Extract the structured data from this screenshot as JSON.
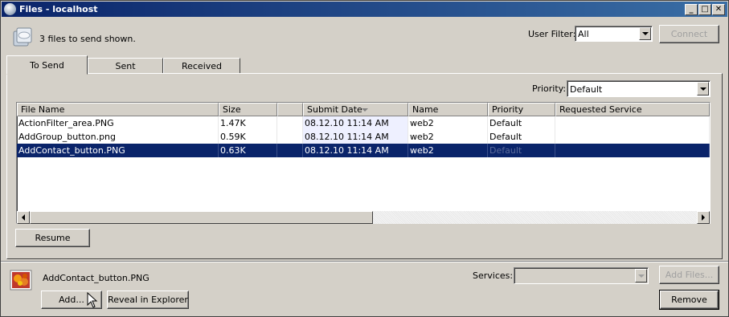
{
  "window": {
    "title": "Files - localhost",
    "min_glyph": "_",
    "max_glyph": "□",
    "close_glyph": "✕"
  },
  "header": {
    "status_text": "3 files to send shown.",
    "user_filter_label": "User Filter:",
    "user_filter_value": "All",
    "connect_label": "Connect"
  },
  "tabs": [
    {
      "label": "To Send",
      "active": true
    },
    {
      "label": "Sent",
      "active": false
    },
    {
      "label": "Received",
      "active": false
    }
  ],
  "priority": {
    "label": "Priority:",
    "value": "Default"
  },
  "table": {
    "columns": [
      "File Name",
      "Size",
      "",
      "Submit Date",
      "Name",
      "Priority",
      "Requested Service"
    ],
    "sorted_column": "Submit Date",
    "rows": [
      {
        "file": "ActionFilter_area.PNG",
        "size": "1.47K",
        "blank": "",
        "date": "08.12.10 11:14 AM",
        "name": "web2",
        "priority": "Default",
        "service": ""
      },
      {
        "file": "AddGroup_button.png",
        "size": "0.59K",
        "blank": "",
        "date": "08.12.10 11:14 AM",
        "name": "web2",
        "priority": "Default",
        "service": ""
      },
      {
        "file": "AddContact_button.PNG",
        "size": "0.63K",
        "blank": "",
        "date": "08.12.10 11:14 AM",
        "name": "web2",
        "priority": "Default",
        "service": "",
        "selected": true
      }
    ]
  },
  "resume_label": "Resume",
  "footer": {
    "selected_file": "AddContact_button.PNG",
    "services_label": "Services:",
    "services_value": "",
    "add_files_label": "Add Files...",
    "add_label": "Add...",
    "reveal_label": "Reveal in Explorer",
    "remove_label": "Remove"
  },
  "icons": {
    "app": "globe-icon",
    "status": "file-stack-icon",
    "file": "image-file-icon",
    "sort": "sort-down-icon"
  },
  "colors": {
    "titlebar_start": "#0a246a",
    "titlebar_end": "#3a6ea5",
    "selection": "#0a246a",
    "face": "#d4d0c8"
  }
}
